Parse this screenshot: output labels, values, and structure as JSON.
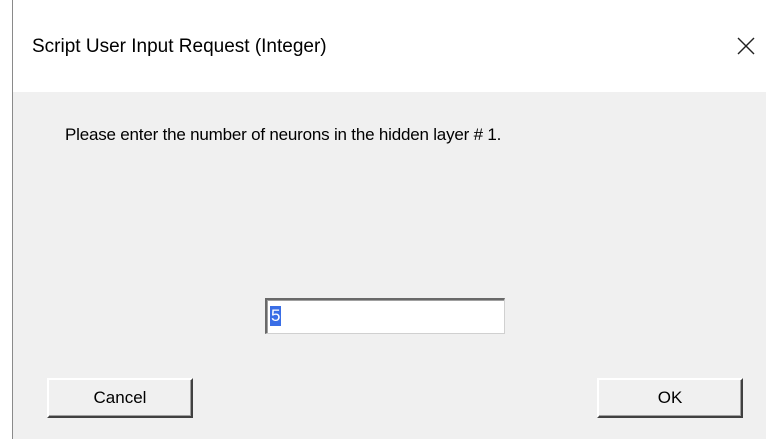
{
  "dialog": {
    "title": "Script User Input Request (Integer)",
    "close_icon": "close-icon",
    "prompt": "Please enter the number of neurons in the hidden layer # 1.",
    "input_value": "5",
    "cancel_label": "Cancel",
    "ok_label": "OK"
  },
  "colors": {
    "dialog_background": "#f0f0f0",
    "selection": "#3a6ee6"
  }
}
